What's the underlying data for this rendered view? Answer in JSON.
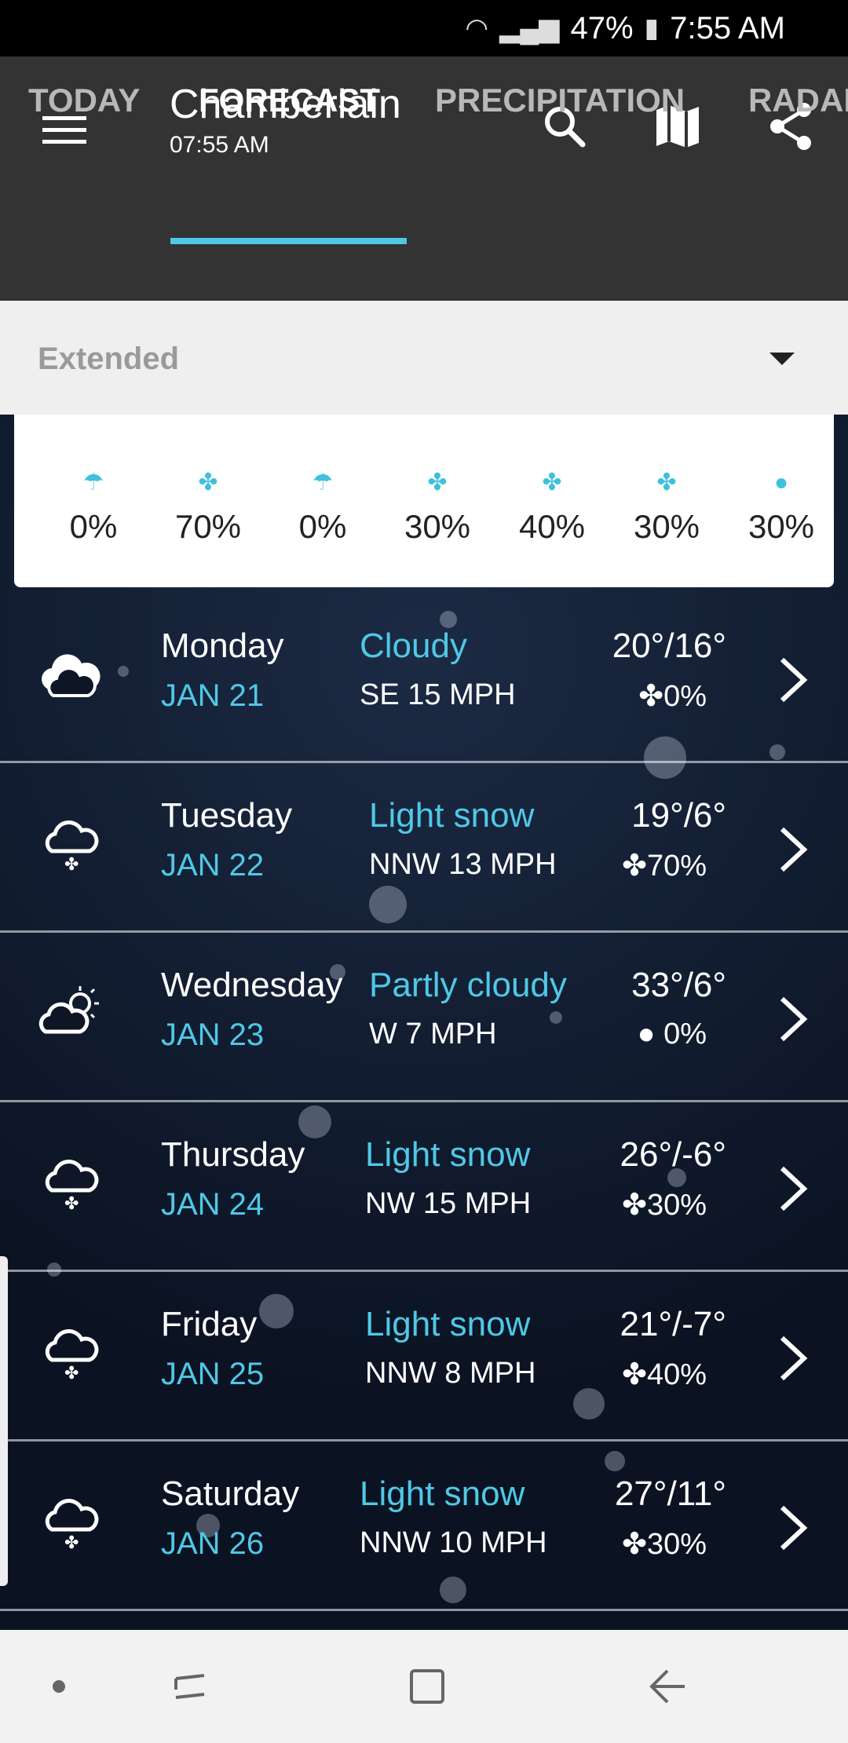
{
  "status": {
    "battery": "47%",
    "time": "7:55 AM"
  },
  "header": {
    "location": "Chamberlain",
    "time": "07:55 AM"
  },
  "tabs": [
    {
      "label": "TODAY"
    },
    {
      "label": "FORECAST"
    },
    {
      "label": "PRECIPITATION"
    },
    {
      "label": "RADAR"
    }
  ],
  "filter": {
    "selected": "Extended"
  },
  "precip_strip": [
    {
      "icon": "umbrella-icon",
      "value": "0%"
    },
    {
      "icon": "snowflake-icon",
      "value": "70%"
    },
    {
      "icon": "umbrella-icon",
      "value": "0%"
    },
    {
      "icon": "snowflake-icon",
      "value": "30%"
    },
    {
      "icon": "snowflake-icon",
      "value": "40%"
    },
    {
      "icon": "snowflake-icon",
      "value": "30%"
    },
    {
      "icon": "raindrop-icon",
      "value": "30%"
    }
  ],
  "days": [
    {
      "day": "Monday",
      "date": "JAN 21",
      "condition": "Cloudy",
      "wind": "SE 15 MPH",
      "temps": "20°/16°",
      "precip": "0%",
      "precip_icon": "snowflake-icon",
      "icon": "cloudy-icon"
    },
    {
      "day": "Tuesday",
      "date": "JAN 22",
      "condition": "Light snow",
      "wind": "NNW 13 MPH",
      "temps": "19°/6°",
      "precip": "70%",
      "precip_icon": "snowflake-icon",
      "icon": "snow-cloud-icon"
    },
    {
      "day": "Wednesday",
      "date": "JAN 23",
      "condition": "Partly cloudy",
      "wind": "W 7 MPH",
      "temps": "33°/6°",
      "precip": "0%",
      "precip_icon": "raindrop-icon",
      "icon": "partly-cloudy-icon"
    },
    {
      "day": "Thursday",
      "date": "JAN 24",
      "condition": "Light snow",
      "wind": "NW 15 MPH",
      "temps": "26°/-6°",
      "precip": "30%",
      "precip_icon": "snowflake-icon",
      "icon": "snow-cloud-icon"
    },
    {
      "day": "Friday",
      "date": "JAN 25",
      "condition": "Light snow",
      "wind": "NNW 8 MPH",
      "temps": "21°/-7°",
      "precip": "40%",
      "precip_icon": "snowflake-icon",
      "icon": "snow-cloud-icon"
    },
    {
      "day": "Saturday",
      "date": "JAN 26",
      "condition": "Light snow",
      "wind": "NNW 10 MPH",
      "temps": "27°/11°",
      "precip": "30%",
      "precip_icon": "snowflake-icon",
      "icon": "snow-cloud-icon"
    }
  ],
  "colors": {
    "accent": "#4fc8e6",
    "appbar": "#333333",
    "status": "#000000"
  }
}
